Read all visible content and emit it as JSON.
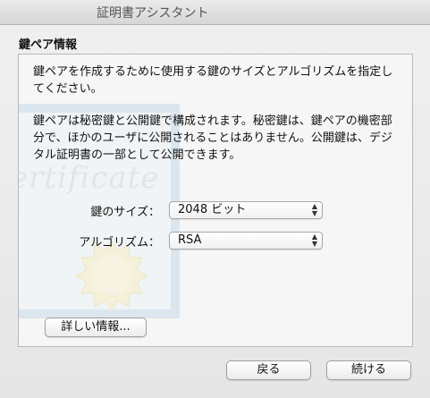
{
  "window": {
    "title": "証明書アシスタント"
  },
  "section_title": "鍵ペア情報",
  "description": {
    "line1": "鍵ペアを作成するために使用する鍵のサイズとアルゴリズムを指定してください。",
    "line2": "鍵ペアは秘密鍵と公開鍵で構成されます。秘密鍵は、鍵ペアの機密部分で、ほかのユーザに公開されることはありません。公開鍵は、デジタル証明書の一部として公開できます。"
  },
  "background": {
    "watermark_text": "ertificate"
  },
  "form": {
    "key_size": {
      "label": "鍵のサイズ：",
      "value": "2048 ビット"
    },
    "algorithm": {
      "label": "アルゴリズム：",
      "value": "RSA"
    }
  },
  "buttons": {
    "details": "詳しい情報...",
    "back": "戻る",
    "continue": "続ける"
  },
  "icons": {
    "popup_arrows": "up-down-arrows-icon",
    "certificate": "certificate-watermark-icon"
  }
}
